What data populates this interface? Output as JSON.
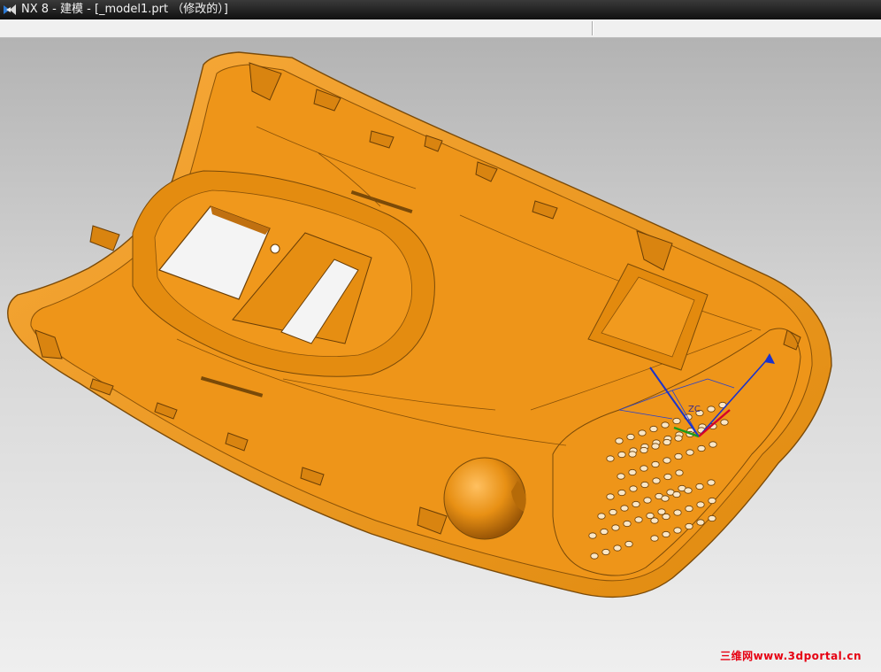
{
  "window": {
    "title": "NX 8 - 建模 - [_model1.prt （修改的）]",
    "app_icon": "nx-logo-icon"
  },
  "viewport": {
    "model": "orange-phone-back-cover",
    "colors": {
      "part_fill": "#f09a1e",
      "part_inner": "#e8900f",
      "edge": "#7a4a08",
      "axis_x": "#d4002a",
      "axis_y": "#1a9a1a",
      "axis_z": "#1a33cc"
    },
    "csys_label": "ZC"
  },
  "watermark": {
    "text": "三维网www.3dportal.cn",
    "color": "#e60012"
  }
}
